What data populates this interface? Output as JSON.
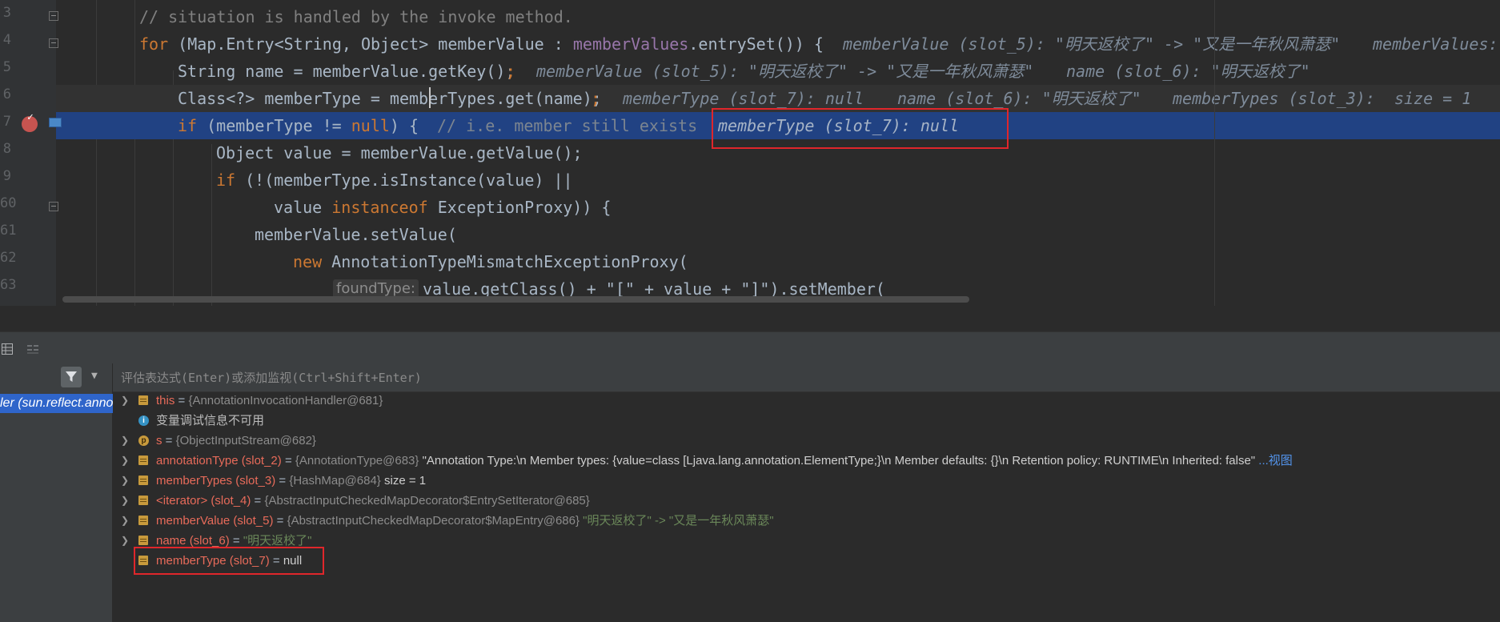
{
  "editor": {
    "line_numbers": [
      "3",
      "4",
      "5",
      "6",
      "7",
      "8",
      "9",
      "60",
      "61",
      "62",
      "63"
    ],
    "lines": [
      {
        "comment": "// situation is handled by the invoke method."
      },
      {
        "kw_for": "for",
        "code_a": " (Map.Entry<String, Object> memberValue : ",
        "field": "memberValues",
        "code_b": ".entrySet()) {",
        "hint_a": "memberValue (slot_5): \"明天返校了\" -> \"又是一年秋风萧瑟\"",
        "hint_b": "memberValues: "
      },
      {
        "code": "String name = memberValue.getKey();",
        "hint_a": "memberValue (slot_5): \"明天返校了\" -> \"又是一年秋风萧瑟\"",
        "hint_b": "name (slot_6): \"明天返校了\""
      },
      {
        "code": "Class<?> memberType = memberTypes.get(name);",
        "hint_a": "memberType (slot_7): null",
        "hint_b": "name (slot_6): \"明天返校了\"",
        "hint_c": "memberTypes (slot_3):  size = 1"
      },
      {
        "kw_if": "if",
        "code_a": " (memberType != ",
        "kw_null": "null",
        "code_b": ") {",
        "comment": "// i.e. member still exists",
        "hint": "memberType (slot_7): null"
      },
      {
        "code": "Object value = memberValue.getValue();"
      },
      {
        "kw_if": "if",
        "code": " (!(memberType.isInstance(value) ||"
      },
      {
        "code_a": "value ",
        "kw": "instanceof",
        "code_b": " ExceptionProxy)) {"
      },
      {
        "code": "memberValue.setValue("
      },
      {
        "kw_new": "new",
        "code": " AnnotationTypeMismatchExceptionProxy("
      },
      {
        "inlay": "foundType:",
        "code": "value.getClass() + \"[\" + value + \"]\").setMember("
      }
    ]
  },
  "debug": {
    "eval_placeholder": "评估表达式(Enter)或添加监视(Ctrl+Shift+Enter)",
    "frame_label": "ler (sun.reflect.anno",
    "vars": [
      {
        "name": "this",
        "eq": " = ",
        "val": "{AnnotationInvocationHandler@681}"
      },
      {
        "info": "变量调试信息不可用"
      },
      {
        "name": "s",
        "eq": " = ",
        "val": "{ObjectInputStream@682}"
      },
      {
        "name": "annotationType (slot_2)",
        "eq": " = ",
        "val": "{AnnotationType@683}",
        "extra": " \"Annotation Type:\\n   Member types: {value=class [Ljava.lang.annotation.ElementType;}\\n   Member defaults: {}\\n   Retention policy: RUNTIME\\n   Inherited: false\" ",
        "link": "...视图"
      },
      {
        "name": "memberTypes (slot_3)",
        "eq": " = ",
        "val": "{HashMap@684}",
        "extra": "  size = 1"
      },
      {
        "name": "<iterator> (slot_4)",
        "eq": " = ",
        "val": "{AbstractInputCheckedMapDecorator$EntrySetIterator@685}"
      },
      {
        "name": "memberValue (slot_5)",
        "eq": " = ",
        "val": "{AbstractInputCheckedMapDecorator$MapEntry@686}",
        "str": " \"明天返校了\" -> \"又是一年秋风萧瑟\""
      },
      {
        "name": "name (slot_6)",
        "eq": " = ",
        "str": "\"明天返校了\""
      },
      {
        "name": "memberType (slot_7)",
        "eq": " = ",
        "val2": "null"
      }
    ]
  }
}
